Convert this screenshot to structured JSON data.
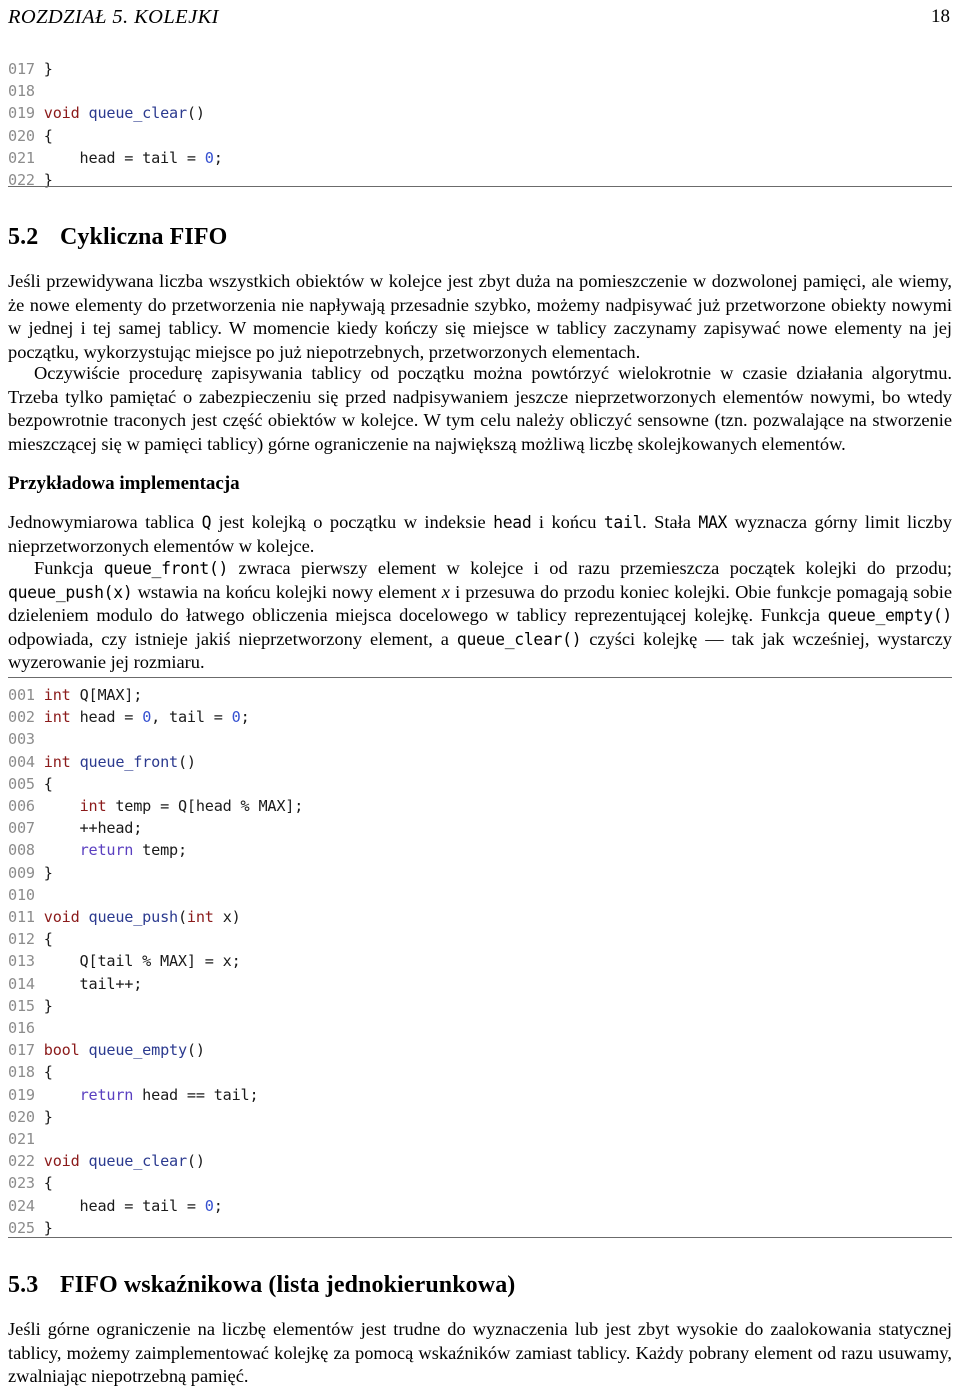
{
  "header": {
    "chapter": "ROZDZIAŁ 5.  KOLEJKI",
    "page_number": "18"
  },
  "colors": {
    "keyword": "#8b1a1a",
    "function": "#2b3a8f",
    "return": "#5a3fc0",
    "number": "#3550d0",
    "line_number": "#8c8c8c",
    "rule": "#6b6b6b",
    "text": "#000000",
    "background": "#ffffff"
  },
  "listing_top": {
    "lines": [
      {
        "n": "017",
        "tokens": [
          {
            "t": "}",
            "c": "pl"
          }
        ]
      },
      {
        "n": "018",
        "tokens": []
      },
      {
        "n": "019",
        "tokens": [
          {
            "t": "void",
            "c": "kw"
          },
          {
            "t": " ",
            "c": "pl"
          },
          {
            "t": "queue_clear",
            "c": "fn"
          },
          {
            "t": "()",
            "c": "pl"
          }
        ]
      },
      {
        "n": "020",
        "tokens": [
          {
            "t": "{",
            "c": "pl"
          }
        ]
      },
      {
        "n": "021",
        "tokens": [
          {
            "t": "    head = tail = ",
            "c": "pl"
          },
          {
            "t": "0",
            "c": "num"
          },
          {
            "t": ";",
            "c": "pl"
          }
        ]
      },
      {
        "n": "022",
        "tokens": [
          {
            "t": "}",
            "c": "pl"
          }
        ]
      }
    ]
  },
  "section_52": {
    "number": "5.2",
    "title": "Cykliczna FIFO"
  },
  "paragraph_1": "Jeśli przewidywana liczba wszystkich obiektów w kolejce jest zbyt duża na pomieszczenie w dozwolonej pamięci, ale wiemy, że nowe elementy do przetworzenia nie napływają przesadnie szybko, możemy nadpisywać już przetworzone obiekty nowymi w jednej i tej samej tablicy. W momencie kiedy kończy się miejsce w tablicy zaczynamy zapisywać nowe elementy na jej początku, wykorzystując miejsce po już niepotrzebnych, przetworzonych elementach.",
  "paragraph_2": "Oczywiście procedurę zapisywania tablicy od początku można powtórzyć wielokrotnie w czasie działania algorytmu. Trzeba tylko pamiętać o zabezpieczeniu się przed nadpisywaniem jeszcze nieprzetworzonych elementów nowymi, bo wtedy bezpowrotnie traconych jest część obiektów w kolejce. W tym celu należy obliczyć sensowne (tzn. pozwalające na stworzenie mieszczącej się w pamięci tablicy) górne ograniczenie na największą możliwą liczbę skolejkowanych elementów.",
  "subsection": {
    "title": "Przykładowa implementacja"
  },
  "paragraph_3": {
    "part_1": "Jednowymiarowa tablica ",
    "code_1": "Q",
    "part_2": " jest kolejką o początku w indeksie ",
    "code_2": "head",
    "part_3": " i końcu ",
    "code_3": "tail",
    "part_4": ". Stała ",
    "code_4": "MAX",
    "part_5": " wyznacza górny limit liczby nieprzetworzonych elementów w kolejce."
  },
  "paragraph_4": {
    "part_1": "Funkcja ",
    "code_1": "queue_front()",
    "part_2": " zwraca pierwszy element w kolejce i od razu przemieszcza początek kolejki do przodu; ",
    "code_2": "queue_push(x)",
    "part_3": " wstawia na końcu kolejki nowy element ",
    "math_1": "x",
    "part_4": " i przesuwa do przodu koniec kolejki. Obie funkcje pomagają sobie dzieleniem modulo do łatwego obliczenia miejsca docelowego w tablicy reprezentującej kolejkę. Funkcja ",
    "code_3": "queue_empty()",
    "part_5": " odpowiada, czy istnieje jakiś nieprzetworzony element, a ",
    "code_4": "queue_clear()",
    "part_6": " czyści kolejkę — tak jak wcześniej, wystarczy wyzerowanie jej rozmiaru."
  },
  "listing_main": {
    "lines": [
      {
        "n": "001",
        "tokens": [
          {
            "t": "int",
            "c": "kw"
          },
          {
            "t": " Q[MAX];",
            "c": "pl"
          }
        ]
      },
      {
        "n": "002",
        "tokens": [
          {
            "t": "int",
            "c": "kw"
          },
          {
            "t": " head = ",
            "c": "pl"
          },
          {
            "t": "0",
            "c": "num"
          },
          {
            "t": ", tail = ",
            "c": "pl"
          },
          {
            "t": "0",
            "c": "num"
          },
          {
            "t": ";",
            "c": "pl"
          }
        ]
      },
      {
        "n": "003",
        "tokens": []
      },
      {
        "n": "004",
        "tokens": [
          {
            "t": "int",
            "c": "kw"
          },
          {
            "t": " ",
            "c": "pl"
          },
          {
            "t": "queue_front",
            "c": "fn"
          },
          {
            "t": "()",
            "c": "pl"
          }
        ]
      },
      {
        "n": "005",
        "tokens": [
          {
            "t": "{",
            "c": "pl"
          }
        ]
      },
      {
        "n": "006",
        "tokens": [
          {
            "t": "    ",
            "c": "pl"
          },
          {
            "t": "int",
            "c": "kw"
          },
          {
            "t": " temp = Q[head % MAX];",
            "c": "pl"
          }
        ]
      },
      {
        "n": "007",
        "tokens": [
          {
            "t": "    ++head;",
            "c": "pl"
          }
        ]
      },
      {
        "n": "008",
        "tokens": [
          {
            "t": "    ",
            "c": "pl"
          },
          {
            "t": "return",
            "c": "ret"
          },
          {
            "t": " temp;",
            "c": "pl"
          }
        ]
      },
      {
        "n": "009",
        "tokens": [
          {
            "t": "}",
            "c": "pl"
          }
        ]
      },
      {
        "n": "010",
        "tokens": []
      },
      {
        "n": "011",
        "tokens": [
          {
            "t": "void",
            "c": "kw"
          },
          {
            "t": " ",
            "c": "pl"
          },
          {
            "t": "queue_push",
            "c": "fn"
          },
          {
            "t": "(",
            "c": "pl"
          },
          {
            "t": "int",
            "c": "kw"
          },
          {
            "t": " x)",
            "c": "pl"
          }
        ]
      },
      {
        "n": "012",
        "tokens": [
          {
            "t": "{",
            "c": "pl"
          }
        ]
      },
      {
        "n": "013",
        "tokens": [
          {
            "t": "    Q[tail % MAX] = x;",
            "c": "pl"
          }
        ]
      },
      {
        "n": "014",
        "tokens": [
          {
            "t": "    tail++;",
            "c": "pl"
          }
        ]
      },
      {
        "n": "015",
        "tokens": [
          {
            "t": "}",
            "c": "pl"
          }
        ]
      },
      {
        "n": "016",
        "tokens": []
      },
      {
        "n": "017",
        "tokens": [
          {
            "t": "bool",
            "c": "kw"
          },
          {
            "t": " ",
            "c": "pl"
          },
          {
            "t": "queue_empty",
            "c": "fn"
          },
          {
            "t": "()",
            "c": "pl"
          }
        ]
      },
      {
        "n": "018",
        "tokens": [
          {
            "t": "{",
            "c": "pl"
          }
        ]
      },
      {
        "n": "019",
        "tokens": [
          {
            "t": "    ",
            "c": "pl"
          },
          {
            "t": "return",
            "c": "ret"
          },
          {
            "t": " head == tail;",
            "c": "pl"
          }
        ]
      },
      {
        "n": "020",
        "tokens": [
          {
            "t": "}",
            "c": "pl"
          }
        ]
      },
      {
        "n": "021",
        "tokens": []
      },
      {
        "n": "022",
        "tokens": [
          {
            "t": "void",
            "c": "kw"
          },
          {
            "t": " ",
            "c": "pl"
          },
          {
            "t": "queue_clear",
            "c": "fn"
          },
          {
            "t": "()",
            "c": "pl"
          }
        ]
      },
      {
        "n": "023",
        "tokens": [
          {
            "t": "{",
            "c": "pl"
          }
        ]
      },
      {
        "n": "024",
        "tokens": [
          {
            "t": "    head = tail = ",
            "c": "pl"
          },
          {
            "t": "0",
            "c": "num"
          },
          {
            "t": ";",
            "c": "pl"
          }
        ]
      },
      {
        "n": "025",
        "tokens": [
          {
            "t": "}",
            "c": "pl"
          }
        ]
      }
    ]
  },
  "section_53": {
    "number": "5.3",
    "title": "FIFO wskaźnikowa (lista jednokierunkowa)"
  },
  "paragraph_5": "Jeśli górne ograniczenie na liczbę elementów jest trudne do wyznaczenia lub jest zbyt wysokie do zaalokowania statycznej tablicy, możemy zaimplementować kolejkę za pomocą wskaźników zamiast tablicy. Każdy pobrany element od razu usuwamy, zwalniając niepotrzebną pamięć."
}
